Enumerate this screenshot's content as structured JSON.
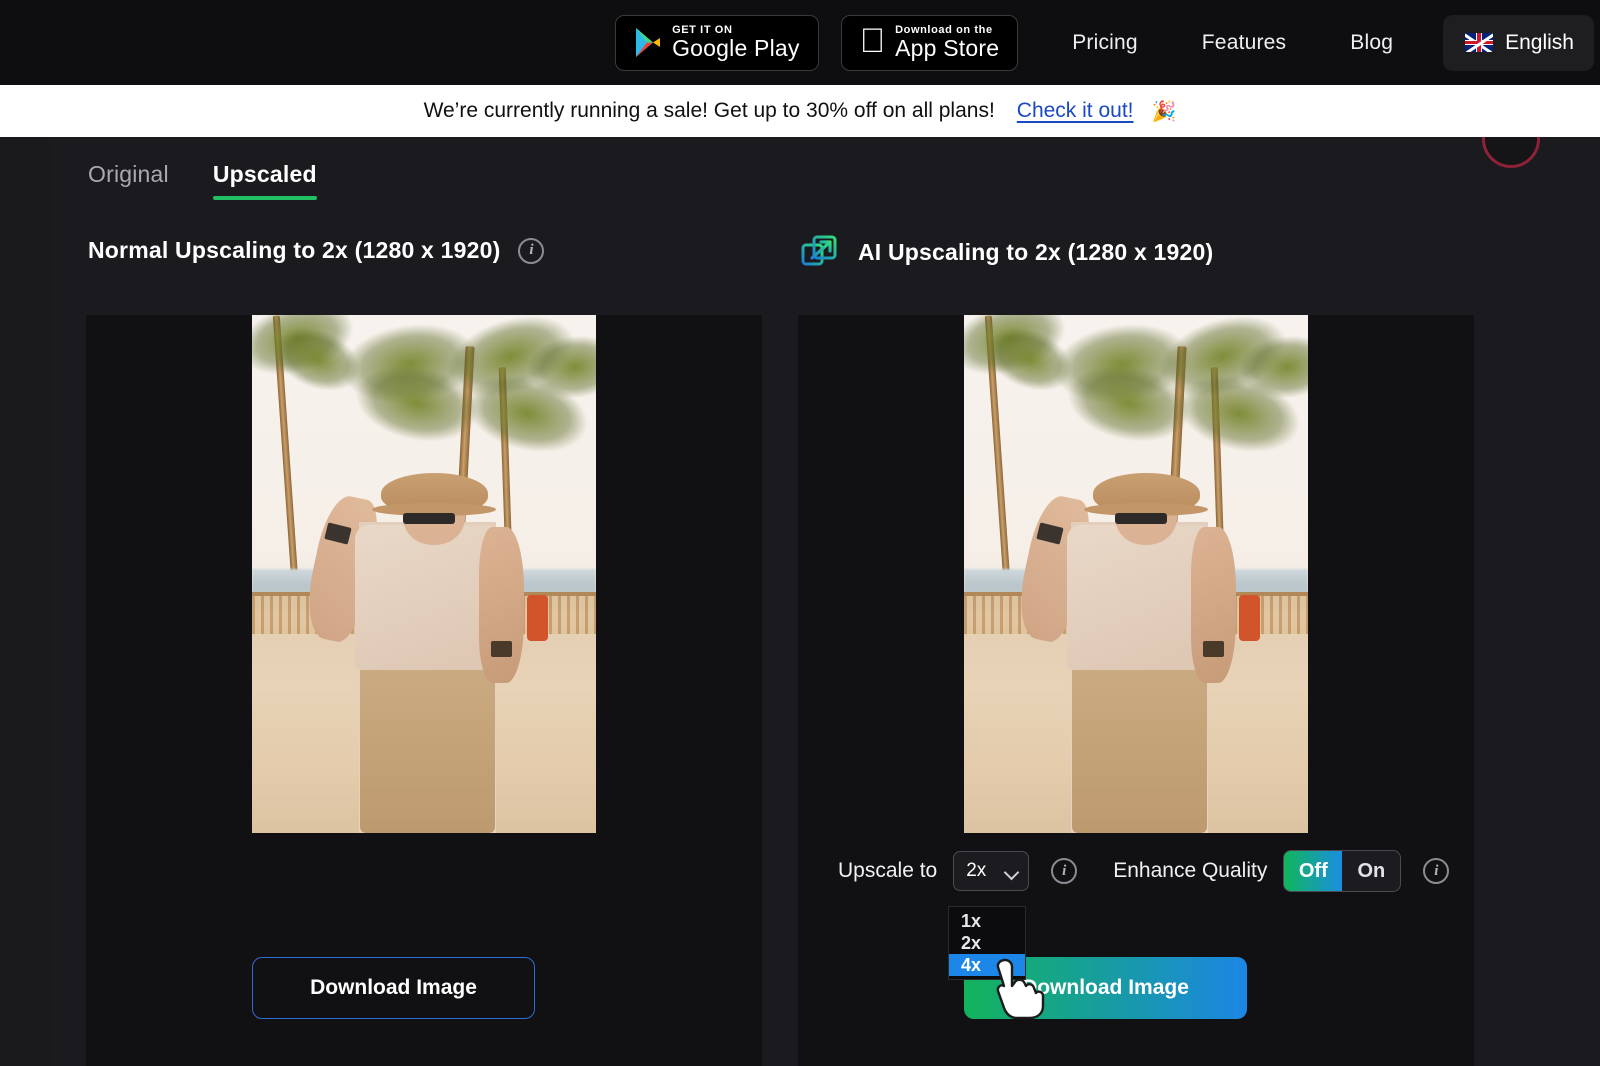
{
  "topnav": {
    "google_play": {
      "small": "GET IT ON",
      "big": "Google Play"
    },
    "app_store": {
      "small": "Download on the",
      "big": "App Store"
    },
    "links": [
      "Pricing",
      "Features",
      "Blog"
    ],
    "language": "English"
  },
  "banner": {
    "text": "We’re currently running a sale! Get up to 30% off on all plans!",
    "link": "Check it out!",
    "emoji": "🎉"
  },
  "tabs": [
    {
      "label": "Original",
      "active": false
    },
    {
      "label": "Upscaled",
      "active": true
    }
  ],
  "panels": {
    "left": {
      "title": "Normal Upscaling to 2x (1280 x 1920)",
      "download_label": "Download Image"
    },
    "right": {
      "title": "AI Upscaling to 2x (1280 x 1920)",
      "download_label": "Download Image",
      "icon": "ai-upscale-expand-icon"
    }
  },
  "controls": {
    "upscale_label": "Upscale to",
    "upscale_value": "2x",
    "upscale_options": [
      "1x",
      "2x",
      "4x"
    ],
    "upscale_highlighted": "4x",
    "enhance_label": "Enhance Quality",
    "enhance_off": "Off",
    "enhance_on": "On",
    "enhance_selected": "Off"
  },
  "colors": {
    "accent_green": "#13b35c",
    "accent_blue": "#1c86e4",
    "tab_underline": "#1fbf62",
    "dropdown_highlight": "#1c87e8",
    "banner_link": "#1b49c4",
    "outline_button_border": "#2f6bd6"
  }
}
